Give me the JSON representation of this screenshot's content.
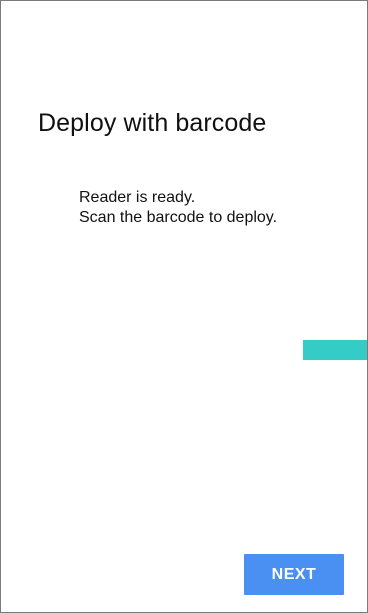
{
  "screen": {
    "title": "Deploy with barcode",
    "message_lines": [
      "Reader is ready.",
      "Scan the barcode to deploy."
    ]
  },
  "footer": {
    "next_label": "NEXT"
  },
  "colors": {
    "accent_teal": "#35ccc8",
    "button_blue": "#4a90f2"
  }
}
